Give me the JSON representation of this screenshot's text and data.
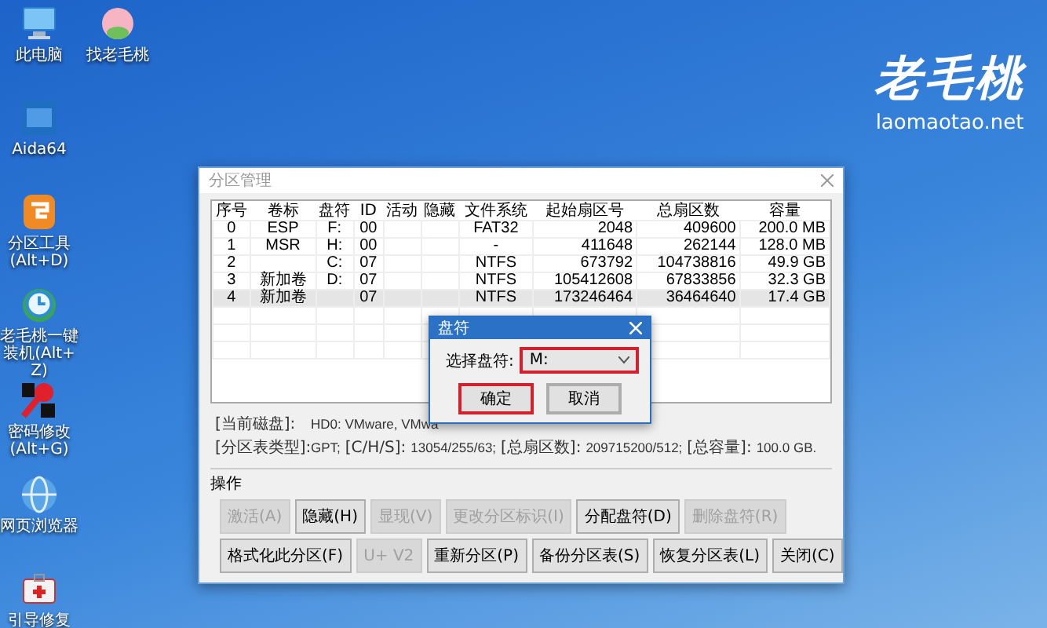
{
  "desktop_icons": [
    {
      "kind": "computer",
      "label": "此电脑"
    },
    {
      "kind": "mascot",
      "label": "找老毛桃"
    },
    {
      "kind": "chip",
      "label": "Aida64"
    },
    {
      "kind": "partition",
      "label": "分区工具(Alt+D)"
    },
    {
      "kind": "installer",
      "label": "老毛桃一键装机(Alt+Z)"
    },
    {
      "kind": "password",
      "label": "密码修改(Alt+G)"
    },
    {
      "kind": "browser",
      "label": "网页浏览器"
    },
    {
      "kind": "medkit",
      "label": "引导修复"
    }
  ],
  "wallpaper_logo": {
    "title": "老毛桃",
    "url": "laomaotao.net"
  },
  "window": {
    "title": "分区管理",
    "table": {
      "columns": [
        "序号",
        "卷标",
        "盘符",
        "ID",
        "活动",
        "隐藏",
        "文件系统",
        "起始扇区号",
        "总扇区数",
        "容量"
      ],
      "rows": [
        {
          "selected": false,
          "cells": [
            "0",
            "ESP",
            "F:",
            "00",
            "",
            "",
            "FAT32",
            "2048",
            "409600",
            "200.0 MB"
          ]
        },
        {
          "selected": false,
          "cells": [
            "1",
            "MSR",
            "H:",
            "00",
            "",
            "",
            "-",
            "411648",
            "262144",
            "128.0 MB"
          ]
        },
        {
          "selected": false,
          "cells": [
            "2",
            "",
            "C:",
            "07",
            "",
            "",
            "NTFS",
            "673792",
            "104738816",
            "49.9 GB"
          ]
        },
        {
          "selected": false,
          "cells": [
            "3",
            "新加卷",
            "D:",
            "07",
            "",
            "",
            "NTFS",
            "105412608",
            "67833856",
            "32.3 GB"
          ]
        },
        {
          "selected": true,
          "cells": [
            "4",
            "新加卷",
            "",
            "07",
            "",
            "",
            "NTFS",
            "173246464",
            "36464640",
            "17.4 GB"
          ]
        }
      ]
    },
    "info": [
      {
        "parts": [
          {
            "kind": "label",
            "text": "[当前磁盘]:"
          },
          {
            "kind": "value",
            "text": "HD0: VMware, VMwa"
          }
        ]
      },
      {
        "parts": [
          {
            "kind": "label",
            "text": "[分区表类型]:"
          },
          {
            "kind": "value",
            "text": "GPT;"
          },
          {
            "kind": "label",
            "text": "[C/H/S]:"
          },
          {
            "kind": "value",
            "text": "13054/255/63;"
          },
          {
            "kind": "label",
            "text": "[总扇区数]:"
          },
          {
            "kind": "value",
            "text": "209715200/512;"
          },
          {
            "kind": "label",
            "text": "[总容量]:"
          },
          {
            "kind": "value",
            "text": "100.0 GB."
          }
        ]
      }
    ],
    "operations": {
      "title": "操作",
      "rows": [
        {
          "buttons": [
            {
              "label": "激活(A)",
              "disabled": true
            },
            {
              "label": "隐藏(H)",
              "disabled": false
            },
            {
              "label": "显现(V)",
              "disabled": true
            },
            {
              "label": "更改分区标识(I)",
              "disabled": true
            },
            {
              "label": "分配盘符(D)",
              "disabled": false
            },
            {
              "label": "删除盘符(R)",
              "disabled": true
            }
          ]
        },
        {
          "buttons": [
            {
              "label": "格式化此分区(F)",
              "disabled": false
            },
            {
              "label": "U+ V2",
              "disabled": true
            },
            {
              "label": "重新分区(P)",
              "disabled": false
            },
            {
              "label": "备份分区表(S)",
              "disabled": false
            },
            {
              "label": "恢复分区表(L)",
              "disabled": false
            },
            {
              "label": "关闭(C)",
              "disabled": false
            }
          ]
        }
      ]
    }
  },
  "dialog": {
    "title": "盘符",
    "field_label": "选择盘符:",
    "dropdown": {
      "value": "M:",
      "highlighted": true
    },
    "buttons": [
      {
        "label": "确定",
        "highlighted": true
      },
      {
        "label": "取消",
        "highlighted": false
      }
    ]
  }
}
